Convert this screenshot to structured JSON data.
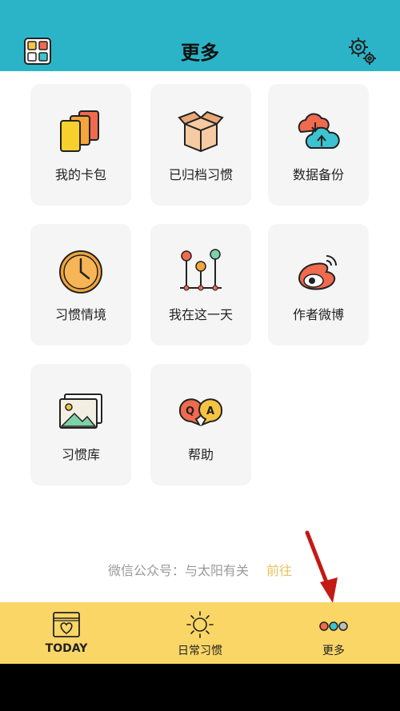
{
  "header": {
    "title": "更多",
    "bg_color": "#2bb4c8"
  },
  "tiles": [
    {
      "label": "我的卡包",
      "icon": "cards-icon"
    },
    {
      "label": "已归档习惯",
      "icon": "archive-box-icon"
    },
    {
      "label": "数据备份",
      "icon": "cloud-backup-icon"
    },
    {
      "label": "习惯情境",
      "icon": "clock-icon"
    },
    {
      "label": "我在这一天",
      "icon": "timeline-icon"
    },
    {
      "label": "作者微博",
      "icon": "weibo-icon"
    },
    {
      "label": "习惯库",
      "icon": "gallery-icon"
    },
    {
      "label": "帮助",
      "icon": "qa-bubbles-icon"
    }
  ],
  "wechat": {
    "text": "微信公众号：与太阳有关",
    "link": "前往"
  },
  "tabbar": {
    "bg_color": "#fad667",
    "tabs": [
      {
        "label": "TODAY",
        "icon": "calendar-heart-icon"
      },
      {
        "label": "日常习惯",
        "icon": "sun-icon"
      },
      {
        "label": "更多",
        "icon": "three-dots-icon"
      }
    ]
  }
}
